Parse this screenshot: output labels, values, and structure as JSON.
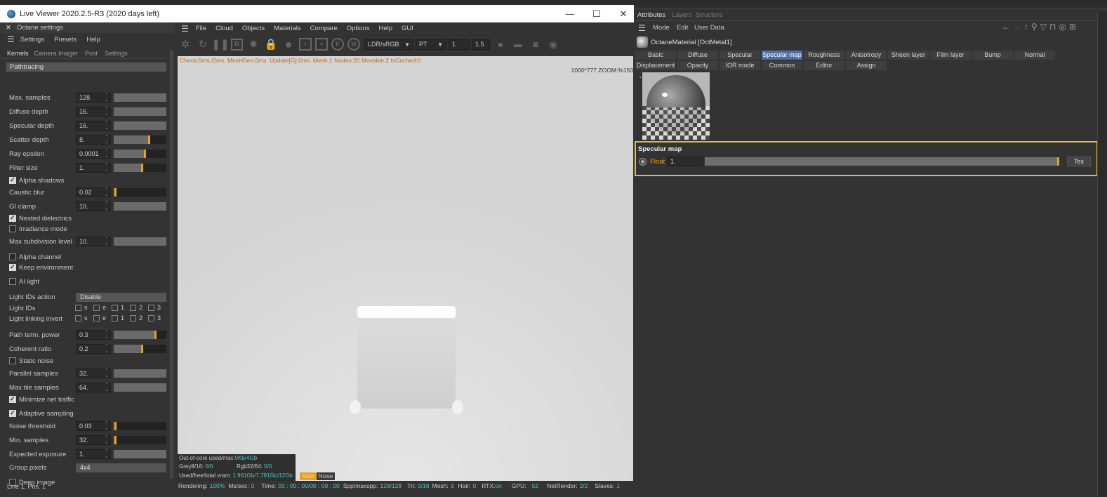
{
  "window": {
    "title": "Live Viewer 2020.2.5-R3 (2020 days left)",
    "minimize": "—",
    "maximize": "☐",
    "close": "✕"
  },
  "octane_settings": {
    "title": "Octane settings",
    "menu": [
      "Settings",
      "Presets",
      "Help"
    ],
    "tabs": [
      "Kernels",
      "Camera Imager",
      "Post",
      "Settings"
    ],
    "section": "Pathtracing",
    "rows": [
      {
        "label": "Max. samples",
        "value": "128.",
        "slider": 0.0
      },
      {
        "label": "Diffuse depth",
        "value": "16.",
        "slider": 0.0
      },
      {
        "label": "Specular depth",
        "value": "16.",
        "slider": 0.0
      },
      {
        "label": "Scatter depth",
        "value": "8.",
        "slider": 0.68
      },
      {
        "label": "Ray epsilon",
        "value": "0.0001",
        "slider": 0.6
      },
      {
        "label": "Filter size",
        "value": "1.",
        "slider": 0.54
      }
    ],
    "alpha_shadows": "Alpha shadows",
    "caustic_blur": {
      "label": "Caustic blur",
      "value": "0.02",
      "slider": 0.04
    },
    "gi_clamp": {
      "label": "GI clamp",
      "value": "10.",
      "slider": 0.0
    },
    "nested_dielectrics": "Nested dielectrics",
    "irradiance_mode": "Irradiance mode",
    "max_subdivision": {
      "label": "Max subdivision level",
      "value": "10.",
      "slider": 0.0
    },
    "alpha_channel": "Alpha channel",
    "keep_environment": "Keep environment",
    "ai_light": "AI light",
    "light_ids_action": {
      "label": "Light IDs action",
      "value": "Disable"
    },
    "light_ids": {
      "label": "Light IDs",
      "options": [
        "s",
        "e",
        "1",
        "2",
        "3"
      ]
    },
    "light_linking_invert": {
      "label": "Light linking invert",
      "options": [
        "s",
        "e",
        "1",
        "2",
        "3"
      ]
    },
    "path_term_power": {
      "label": "Path term. power",
      "value": "0.3",
      "slider": 0.8
    },
    "coherent_ratio": {
      "label": "Coherent ratio",
      "value": "0.2",
      "slider": 0.54
    },
    "static_noise": "Static noise",
    "parallel_samples": {
      "label": "Parallel samples",
      "value": "32.",
      "slider": 0.0
    },
    "max_tile_samples": {
      "label": "Max tile samples",
      "value": "64.",
      "slider": 0.0
    },
    "minimize_net": "Minimize net traffic",
    "adaptive_sampling": "Adaptive sampling",
    "noise_threshold": {
      "label": "Noise threshold",
      "value": "0.03",
      "slider": 0.04
    },
    "min_samples": {
      "label": "Min. samples",
      "value": "32.",
      "slider": 0.04
    },
    "expected_exposure": {
      "label": "Expected exposure",
      "value": "1.",
      "slider": 0.0
    },
    "group_pixels": {
      "label": "Group pixels",
      "value": "4x4"
    },
    "deep_image": "Deep image",
    "status": "Line 1, Pos. 1"
  },
  "viewer_menu": [
    "File",
    "Cloud",
    "Objects",
    "Materials",
    "Compare",
    "Options",
    "Help",
    "GUI"
  ],
  "toolbar": {
    "color_space": "LDR/sRGB",
    "kernel": "PT",
    "value1": "1",
    "value2": "1.5"
  },
  "viewport": {
    "overlay": "Check:0ms./2ms. MeshGen:0ms. Update[G]:0ms. Mesh:1 Nodes:20 Movable:2 txCached:0",
    "resolution": "1000*777 ZOOM:%150",
    "info": {
      "outofcore_label": "Out-of-core used/max:",
      "outofcore_value": "0Kb/4Gb",
      "grey_label": "Grey8/16: ",
      "grey_value": "0/0",
      "rgb_label": "Rgb32/64: ",
      "rgb_value": "0/0",
      "vram_label": "Used/free/total vram: ",
      "vram_value": "1.961Gb/7.791Gb/12Gb",
      "main": "Main",
      "noise": "Noise"
    }
  },
  "status_bar": {
    "rendering_label": "Rendering:",
    "rendering": "100%",
    "ms_label": "Ms/sec:",
    "ms": "0",
    "time_label": "Time:",
    "time": "00 : 00 : 00/00 : 00 : 00",
    "spp_label": "Spp/maxspp:",
    "spp": "128/128",
    "tri_label": "Tri:",
    "tri": "0/16",
    "mesh_label": "Mesh:",
    "mesh": "3",
    "hair_label": "Hair:",
    "hair": "0",
    "rtx_label": "RTX:",
    "rtx": "on",
    "gpu_label": "GPU:",
    "gpu": "52",
    "netrender_label": "NetRender:",
    "netrender": "2/2",
    "slaves_label": "Slaves:",
    "slaves": "1"
  },
  "attributes": {
    "tabs": [
      "Attributes",
      "Layers",
      "Structure"
    ],
    "menu": [
      "Mode",
      "Edit",
      "User Data"
    ],
    "object": "OctaneMaterial [OctMetal1]",
    "channel_tabs_row1": [
      "Basic",
      "Diffuse",
      "Specular",
      "Specular map",
      "Roughness",
      "Anisotropy",
      "Sheen layer",
      "Film layer",
      "Bump",
      "Normal"
    ],
    "channel_tabs_row2": [
      "Displacement",
      "Opacity",
      "IOR mode",
      "Common",
      "Editor",
      "Assign"
    ],
    "active_tab": "Specular map",
    "section_title": "Specular map",
    "float_label": "Float",
    "float_value": "1.",
    "float_slider": 1.0,
    "tex_button": "Tex"
  },
  "colors": {
    "accent": "#e8a020",
    "highlight_border": "#e8b83a",
    "active_tab": "#4a6fa5",
    "status_value": "#4fc3c3"
  }
}
